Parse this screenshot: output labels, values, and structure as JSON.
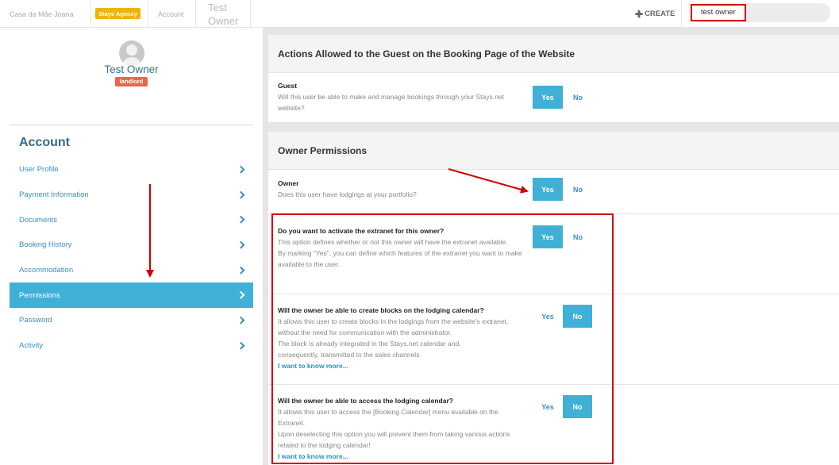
{
  "topbar": {
    "property_name": "Casa da Mãe Joana",
    "agency_badge": "Stays Agency",
    "account_crumb": "Account",
    "owner_crumb": "Test Owner",
    "create_label": "CREATE",
    "search_value": "test owner"
  },
  "profile": {
    "name": "Test Owner",
    "role": "landlord"
  },
  "sidebar": {
    "title": "Account",
    "items": [
      {
        "label": "User Profile"
      },
      {
        "label": "Payment Information"
      },
      {
        "label": "Documents"
      },
      {
        "label": "Booking History"
      },
      {
        "label": "Accommodation"
      },
      {
        "label": "Permissions",
        "active": true
      },
      {
        "label": "Password"
      },
      {
        "label": "Activity"
      }
    ]
  },
  "guest_card": {
    "title": "Actions Allowed to the Guest on the Booking Page of the Website",
    "guest": {
      "title": "Guest",
      "desc": "Will this user be able to make and manage bookings through your Stays.net website?",
      "yes": "Yes",
      "no": "No",
      "selected": "Yes"
    }
  },
  "owner_card": {
    "title": "Owner Permissions",
    "owner": {
      "title": "Owner",
      "desc": "Does this user have lodgings at your portfolio?",
      "yes": "Yes",
      "no": "No",
      "selected": "Yes"
    },
    "extranet": {
      "title": "Do you want to activate the extranet for this owner?",
      "desc1": "This option defines whether or not this owner will have the extranet available.",
      "desc2": "By marking \"Yes\", you can define which features of the extranet you want to make available to the user.",
      "yes": "Yes",
      "no": "No",
      "selected": "Yes"
    },
    "blocks": {
      "title": "Will the owner be able to create blocks on the lodging calendar?",
      "desc1": "It allows this user to create blocks in the lodgings from the website's extranet, without the need for communication with the administrator.",
      "desc2": "The block is already integrated in the Stays.net calendar and, consequently, transmitted to the sales channels.",
      "link": "I want to know more...",
      "yes": "Yes",
      "no": "No",
      "selected": "No"
    },
    "calendar": {
      "title": "Will the owner be able to access the lodging calendar?",
      "desc1": "It allows this user to access the [Booking Calendar] menu available on the Extranet.",
      "desc2": "Upon deselecting this option you will prevent them from taking various actions related to the lodging calendar!",
      "link": "I want to know more...",
      "yes": "Yes",
      "no": "No",
      "selected": "No"
    }
  },
  "colors": {
    "accent": "#41b0d6",
    "link": "#3b8fc0",
    "badge_agency": "#f0b400",
    "badge_role": "#e8674a",
    "annotation": "#d40000"
  }
}
